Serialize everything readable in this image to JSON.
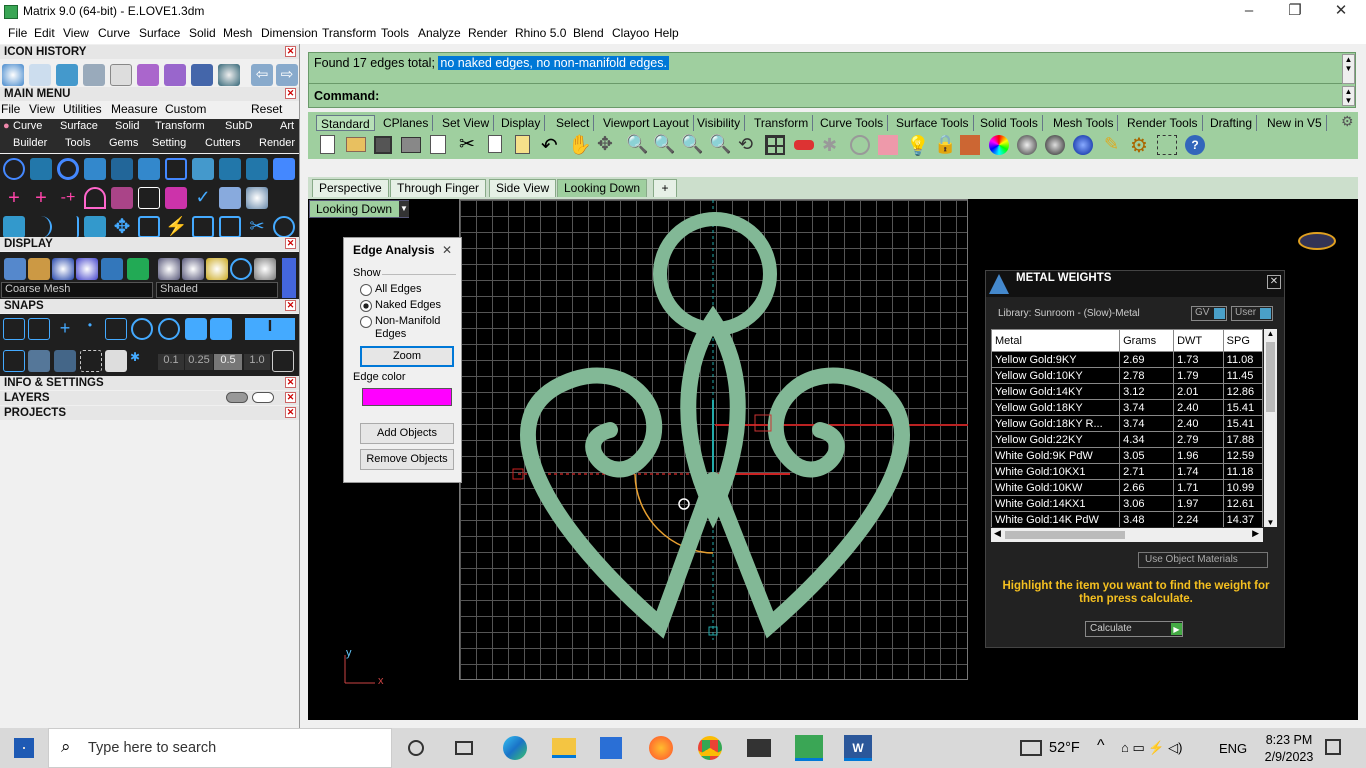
{
  "window": {
    "title": "Matrix 9.0 (64-bit) - E.LOVE1.3dm"
  },
  "menubar": [
    "File",
    "Edit",
    "View",
    "Curve",
    "Surface",
    "Solid",
    "Mesh",
    "Dimension",
    "Transform",
    "Tools",
    "Analyze",
    "Render",
    "Rhino 5.0",
    "Blend",
    "Clayoo",
    "Help"
  ],
  "left": {
    "icon_history": "ICON HISTORY",
    "main_menu": "MAIN MENU",
    "mm_menu": [
      "File",
      "View",
      "Utilities",
      "Measure",
      "Custom"
    ],
    "mm_reset": "Reset",
    "mm_row1": [
      "Curve",
      "Surface",
      "Solid",
      "Transform",
      "SubD",
      "Art"
    ],
    "mm_row2": [
      "Builder",
      "Tools",
      "Gems",
      "Setting",
      "Cutters",
      "Render"
    ],
    "display": "DISPLAY",
    "coarse": "Coarse Mesh",
    "shaded": "Shaded",
    "snaps": "SNAPS",
    "snap_vals": [
      "0.1",
      "0.25",
      "0.5",
      "1.0"
    ],
    "info": "INFO & SETTINGS",
    "layers": "LAYERS",
    "projects": "PROJECTS"
  },
  "command": {
    "history_plain": "Found 17 edges total;",
    "history_highlight": "no naked edges, no non-manifold edges.",
    "prompt": "Command:"
  },
  "toolbar_tabs": [
    "Standard",
    "CPlanes",
    "Set View",
    "Display",
    "Select",
    "Viewport Layout",
    "Visibility",
    "Transform",
    "Curve Tools",
    "Surface Tools",
    "Solid Tools",
    "Mesh Tools",
    "Render Tools",
    "Drafting",
    "New in V5"
  ],
  "viewport_tabs": [
    "Perspective",
    "Through Finger",
    "Side View",
    "Looking Down"
  ],
  "viewport_label": "Looking Down",
  "edge_dialog": {
    "title": "Edge Analysis",
    "show": "Show",
    "opt1": "All Edges",
    "opt2": "Naked Edges",
    "opt3": "Non-Manifold Edges",
    "zoom": "Zoom",
    "edge_color_label": "Edge color",
    "edge_color": "#ff00ff",
    "add": "Add Objects",
    "remove": "Remove Objects"
  },
  "metal": {
    "title": "METAL WEIGHTS",
    "library": "Library: Sunroom - (Slow)-Metal",
    "gv": "GV",
    "user": "User",
    "headers": [
      "Metal",
      "Grams",
      "DWT",
      "SPG"
    ],
    "rows": [
      [
        "Yellow Gold:9KY",
        "2.69",
        "1.73",
        "11.08"
      ],
      [
        "Yellow Gold:10KY",
        "2.78",
        "1.79",
        "11.45"
      ],
      [
        "Yellow Gold:14KY",
        "3.12",
        "2.01",
        "12.86"
      ],
      [
        "Yellow Gold:18KY",
        "3.74",
        "2.40",
        "15.41"
      ],
      [
        "Yellow Gold:18KY R...",
        "3.74",
        "2.40",
        "15.41"
      ],
      [
        "Yellow Gold:22KY",
        "4.34",
        "2.79",
        "17.88"
      ],
      [
        "White Gold:9K PdW",
        "3.05",
        "1.96",
        "12.59"
      ],
      [
        "White Gold:10KX1",
        "2.71",
        "1.74",
        "11.18"
      ],
      [
        "White Gold:10KW",
        "2.66",
        "1.71",
        "10.99"
      ],
      [
        "White Gold:14KX1",
        "3.06",
        "1.97",
        "12.61"
      ],
      [
        "White Gold:14K PdW",
        "3.48",
        "2.24",
        "14.37"
      ]
    ],
    "use_obj": "Use Object Materials",
    "hint": "Highlight the item you want to find the weight for then press calculate.",
    "calculate": "Calculate"
  },
  "taskbar": {
    "search_placeholder": "Type here to search",
    "temp": "52°F",
    "lang": "ENG",
    "time": "8:23 PM",
    "date": "2/9/2023"
  },
  "axes": {
    "y": "y",
    "x": "x"
  }
}
